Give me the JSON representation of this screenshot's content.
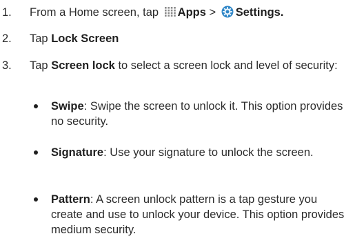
{
  "steps": [
    {
      "num": "1.",
      "prefix": "From a Home screen, tap",
      "apps_label": "Apps",
      "separator": ">",
      "settings_label": "Settings",
      "end": "."
    },
    {
      "num": "2.",
      "prefix": "Tap",
      "target": "Lock Screen"
    },
    {
      "num": "3.",
      "prefix": "Tap",
      "target": "Screen lock",
      "suffix": "to select a screen lock and level of security:"
    }
  ],
  "options": [
    {
      "name": "Swipe",
      "description": ": Swipe the screen to unlock it. This option provides no security."
    },
    {
      "name": "Signature",
      "description": ": Use your signature to unlock the screen."
    },
    {
      "name": "Pattern",
      "description": ": A screen unlock pattern is a tap gesture you create and use to unlock your device. This option provides medium security."
    }
  ],
  "icons": {
    "apps": "apps-grid-icon",
    "settings": "settings-gear-icon"
  },
  "colors": {
    "text": "#2b2b2b",
    "settings_icon_blue": "#2f86c7"
  }
}
